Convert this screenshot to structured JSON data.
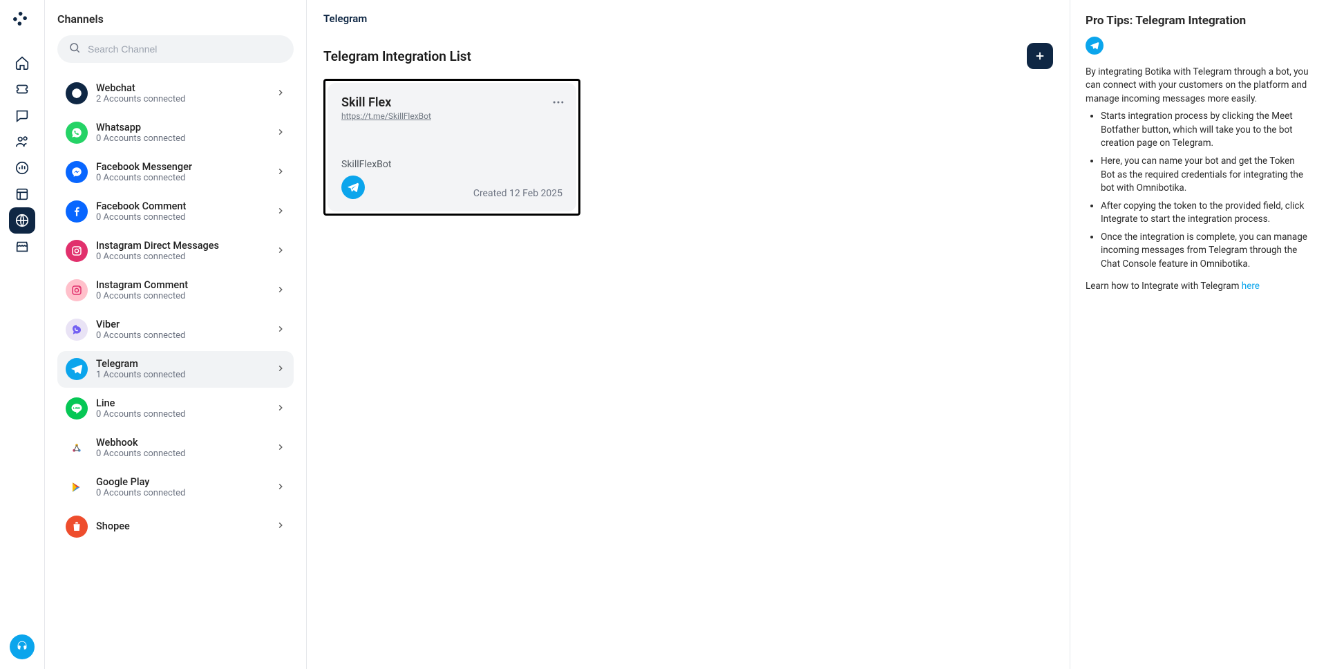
{
  "search": {
    "placeholder": "Search Channel"
  },
  "channels_title": "Channels",
  "channels": [
    {
      "name": "Webchat",
      "sub": "2 Accounts connected",
      "color": "#0f2744",
      "icon": "globe",
      "selected": false
    },
    {
      "name": "Whatsapp",
      "sub": "0 Accounts connected",
      "color": "#25D366",
      "icon": "whatsapp",
      "selected": false
    },
    {
      "name": "Facebook Messenger",
      "sub": "0 Accounts connected",
      "color": "#0866FF",
      "icon": "messenger",
      "selected": false
    },
    {
      "name": "Facebook Comment",
      "sub": "0 Accounts connected",
      "color": "#0866FF",
      "icon": "facebook",
      "selected": false
    },
    {
      "name": "Instagram Direct Messages",
      "sub": "0 Accounts connected",
      "color": "#E1306C",
      "icon": "instagram",
      "selected": false
    },
    {
      "name": "Instagram Comment",
      "sub": "0 Accounts connected",
      "color": "#FFC0CB",
      "icon": "instagram",
      "light": true,
      "selected": false
    },
    {
      "name": "Viber",
      "sub": "0 Accounts connected",
      "color": "#E9E3F5",
      "icon": "viber",
      "light": true,
      "selected": false
    },
    {
      "name": "Telegram",
      "sub": "1 Accounts connected",
      "color": "#0BA5EC",
      "icon": "telegram",
      "selected": true
    },
    {
      "name": "Line",
      "sub": "0 Accounts connected",
      "color": "#06C755",
      "icon": "line",
      "selected": false
    },
    {
      "name": "Webhook",
      "sub": "0 Accounts connected",
      "color": "#ffffff",
      "icon": "webhook",
      "light": true,
      "selected": false
    },
    {
      "name": "Google Play",
      "sub": "0 Accounts connected",
      "color": "#ffffff",
      "icon": "play",
      "light": true,
      "selected": false
    },
    {
      "name": "Shopee",
      "sub": "",
      "color": "#EE4D2D",
      "icon": "shopee",
      "selected": false
    }
  ],
  "nav_items": [
    {
      "name": "home",
      "active": false
    },
    {
      "name": "ticket",
      "active": false
    },
    {
      "name": "chat",
      "active": false
    },
    {
      "name": "contacts",
      "active": false
    },
    {
      "name": "analytics",
      "active": false
    },
    {
      "name": "template",
      "active": false
    },
    {
      "name": "channels",
      "active": true
    },
    {
      "name": "storefront",
      "active": false
    }
  ],
  "breadcrumb": "Telegram",
  "list_title": "Telegram Integration List",
  "card": {
    "title": "Skill Flex",
    "link": "https://t.me/SkillFlexBot",
    "bot_name": "SkillFlexBot",
    "created": "Created 12 Feb 2025"
  },
  "tips": {
    "title": "Pro Tips: Telegram Integration",
    "intro": "By integrating Botika with Telegram through a bot, you can connect with your customers on the platform and manage incoming messages more easily.",
    "bullets": [
      "Starts integration process by clicking the Meet Botfather button, which will take you to the bot creation page on Telegram.",
      "Here, you can name your bot and get the Token Bot as the required credentials for integrating the bot with Omnibotika.",
      "After copying the token to the provided field, click Integrate to start the integration process.",
      "Once the integration is complete, you can manage incoming messages from Telegram through the Chat Console feature in Omnibotika."
    ],
    "learn_prefix": "Learn how to Integrate with Telegram ",
    "learn_link_text": "here"
  }
}
